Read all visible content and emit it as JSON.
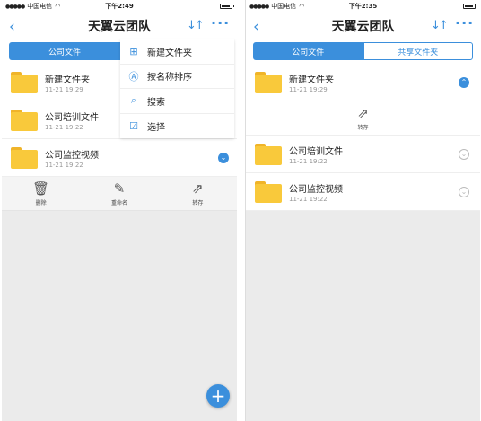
{
  "left": {
    "status": {
      "carrier": "中国电信",
      "time": "下午2:49"
    },
    "nav": {
      "title": "天翼云团队"
    },
    "tabs": [
      {
        "label": "公司文件"
      }
    ],
    "files": [
      {
        "name": "新建文件夹",
        "date": "11-21 19:29"
      },
      {
        "name": "公司培训文件",
        "date": "11-21 19:22"
      },
      {
        "name": "公司监控视频",
        "date": "11-21 19:22"
      }
    ],
    "actions": [
      {
        "icon": "trash-icon",
        "label": "删除"
      },
      {
        "icon": "edit-icon",
        "label": "重命名"
      },
      {
        "icon": "share-icon",
        "label": "转存"
      }
    ],
    "menu": [
      {
        "icon": "new-folder-icon",
        "label": "新建文件夹"
      },
      {
        "icon": "sort-name-icon",
        "label": "按名称排序"
      },
      {
        "icon": "search-icon",
        "label": "搜索"
      },
      {
        "icon": "select-icon",
        "label": "选择"
      }
    ]
  },
  "right": {
    "status": {
      "carrier": "中国电信",
      "time": "下午2:35"
    },
    "nav": {
      "title": "天翼云团队"
    },
    "tabs": [
      {
        "label": "公司文件"
      },
      {
        "label": "共享文件夹"
      }
    ],
    "files": [
      {
        "name": "新建文件夹",
        "date": "11-21 19:29"
      },
      {
        "name": "公司培训文件",
        "date": "11-21 19:22"
      },
      {
        "name": "公司监控视频",
        "date": "11-21 19:22"
      }
    ],
    "inline_action": {
      "icon": "share-icon",
      "label": "转存"
    }
  },
  "colors": {
    "accent": "#3b8fdc",
    "folder": "#f9c93b"
  }
}
